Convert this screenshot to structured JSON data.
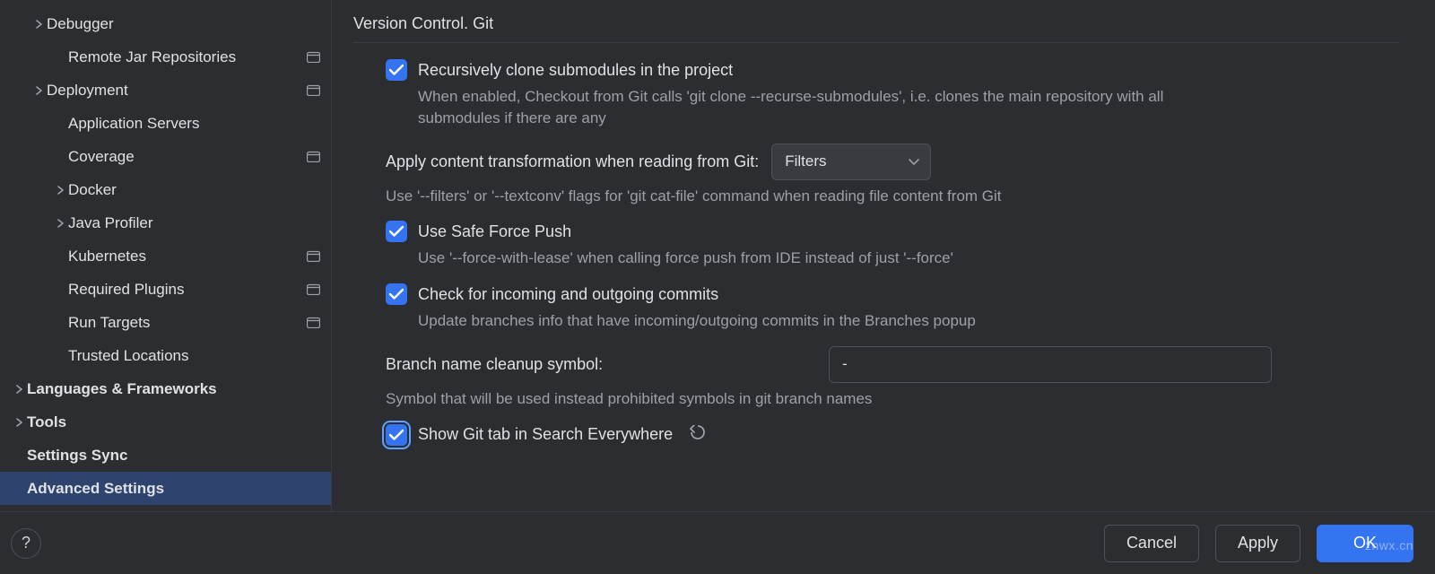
{
  "header": {
    "title": "Version Control. Git"
  },
  "sidebar": {
    "items": [
      {
        "label": "Debugger",
        "indent": 1,
        "expandable": true,
        "badge": false,
        "bold": false
      },
      {
        "label": "Remote Jar Repositories",
        "indent": 2,
        "expandable": false,
        "badge": true,
        "bold": false
      },
      {
        "label": "Deployment",
        "indent": 1,
        "expandable": true,
        "badge": true,
        "bold": false
      },
      {
        "label": "Application Servers",
        "indent": 2,
        "expandable": false,
        "badge": false,
        "bold": false
      },
      {
        "label": "Coverage",
        "indent": 2,
        "expandable": false,
        "badge": true,
        "bold": false
      },
      {
        "label": "Docker",
        "indent": 2,
        "expandable": true,
        "badge": false,
        "bold": false
      },
      {
        "label": "Java Profiler",
        "indent": 2,
        "expandable": true,
        "badge": false,
        "bold": false
      },
      {
        "label": "Kubernetes",
        "indent": 2,
        "expandable": false,
        "badge": true,
        "bold": false
      },
      {
        "label": "Required Plugins",
        "indent": 2,
        "expandable": false,
        "badge": true,
        "bold": false
      },
      {
        "label": "Run Targets",
        "indent": 2,
        "expandable": false,
        "badge": true,
        "bold": false
      },
      {
        "label": "Trusted Locations",
        "indent": 2,
        "expandable": false,
        "badge": false,
        "bold": false
      },
      {
        "label": "Languages & Frameworks",
        "indent": 0,
        "expandable": true,
        "badge": false,
        "bold": true
      },
      {
        "label": "Tools",
        "indent": 0,
        "expandable": true,
        "badge": false,
        "bold": true
      },
      {
        "label": "Settings Sync",
        "indent": 0,
        "expandable": false,
        "badge": false,
        "bold": true
      },
      {
        "label": "Advanced Settings",
        "indent": 0,
        "expandable": false,
        "badge": false,
        "bold": true,
        "selected": true
      }
    ]
  },
  "settings": {
    "recursive_clone": {
      "label": "Recursively clone submodules in the project",
      "desc": "When enabled, Checkout from Git calls 'git clone --recurse-submodules', i.e. clones the main repository with all submodules if there are any"
    },
    "content_transform": {
      "label": "Apply content transformation when reading from Git:",
      "value": "Filters",
      "desc": "Use '--filters' or '--textconv' flags for 'git cat-file' command when reading file content from Git"
    },
    "safe_force_push": {
      "label": "Use Safe Force Push",
      "desc": "Use '--force-with-lease' when calling force push from IDE instead of just '--force'"
    },
    "check_commits": {
      "label": "Check for incoming and outgoing commits",
      "desc": "Update branches info that have incoming/outgoing commits in the Branches popup"
    },
    "branch_cleanup": {
      "label": "Branch name cleanup symbol:",
      "value": "-",
      "desc": "Symbol that will be used instead prohibited symbols in git branch names"
    },
    "show_git_tab": {
      "label": "Show Git tab in Search Everywhere"
    }
  },
  "footer": {
    "help": "?",
    "cancel": "Cancel",
    "apply": "Apply",
    "ok": "OK"
  },
  "watermark": "znwx.cn"
}
